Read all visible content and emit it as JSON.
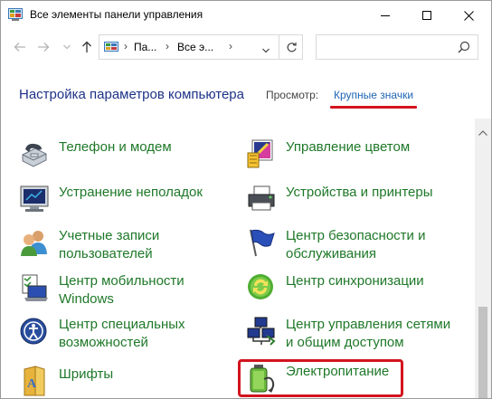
{
  "window": {
    "title": "Все элементы панели управления"
  },
  "address_bar": {
    "crumbs": [
      "Па...",
      "Все э..."
    ],
    "search_placeholder": ""
  },
  "header": {
    "title": "Настройка параметров компьютера",
    "view_label": "Просмотр:",
    "view_value": "Крупные значки"
  },
  "items": [
    {
      "label": "Телефон и модем",
      "icon": "phone-modem-icon"
    },
    {
      "label": "Управление цветом",
      "icon": "color-management-icon"
    },
    {
      "label": "Устранение неполадок",
      "icon": "troubleshooting-icon"
    },
    {
      "label": "Устройства и принтеры",
      "icon": "devices-printers-icon"
    },
    {
      "label": "Учетные записи\nпользователей",
      "icon": "user-accounts-icon"
    },
    {
      "label": "Центр безопасности и\nобслуживания",
      "icon": "security-flag-icon"
    },
    {
      "label": "Центр мобильности\nWindows",
      "icon": "mobility-center-icon"
    },
    {
      "label": "Центр синхронизации",
      "icon": "sync-center-icon"
    },
    {
      "label": "Центр специальных\nвозможностей",
      "icon": "accessibility-icon"
    },
    {
      "label": "Центр управления сетями\nи общим доступом",
      "icon": "network-center-icon"
    },
    {
      "label": "Шрифты",
      "icon": "fonts-folder-icon"
    },
    {
      "label": "Электропитание",
      "icon": "power-options-icon"
    }
  ],
  "colors": {
    "link_green": "#1e7828",
    "header_blue": "#1e3287",
    "highlight_red": "#d2141e"
  }
}
